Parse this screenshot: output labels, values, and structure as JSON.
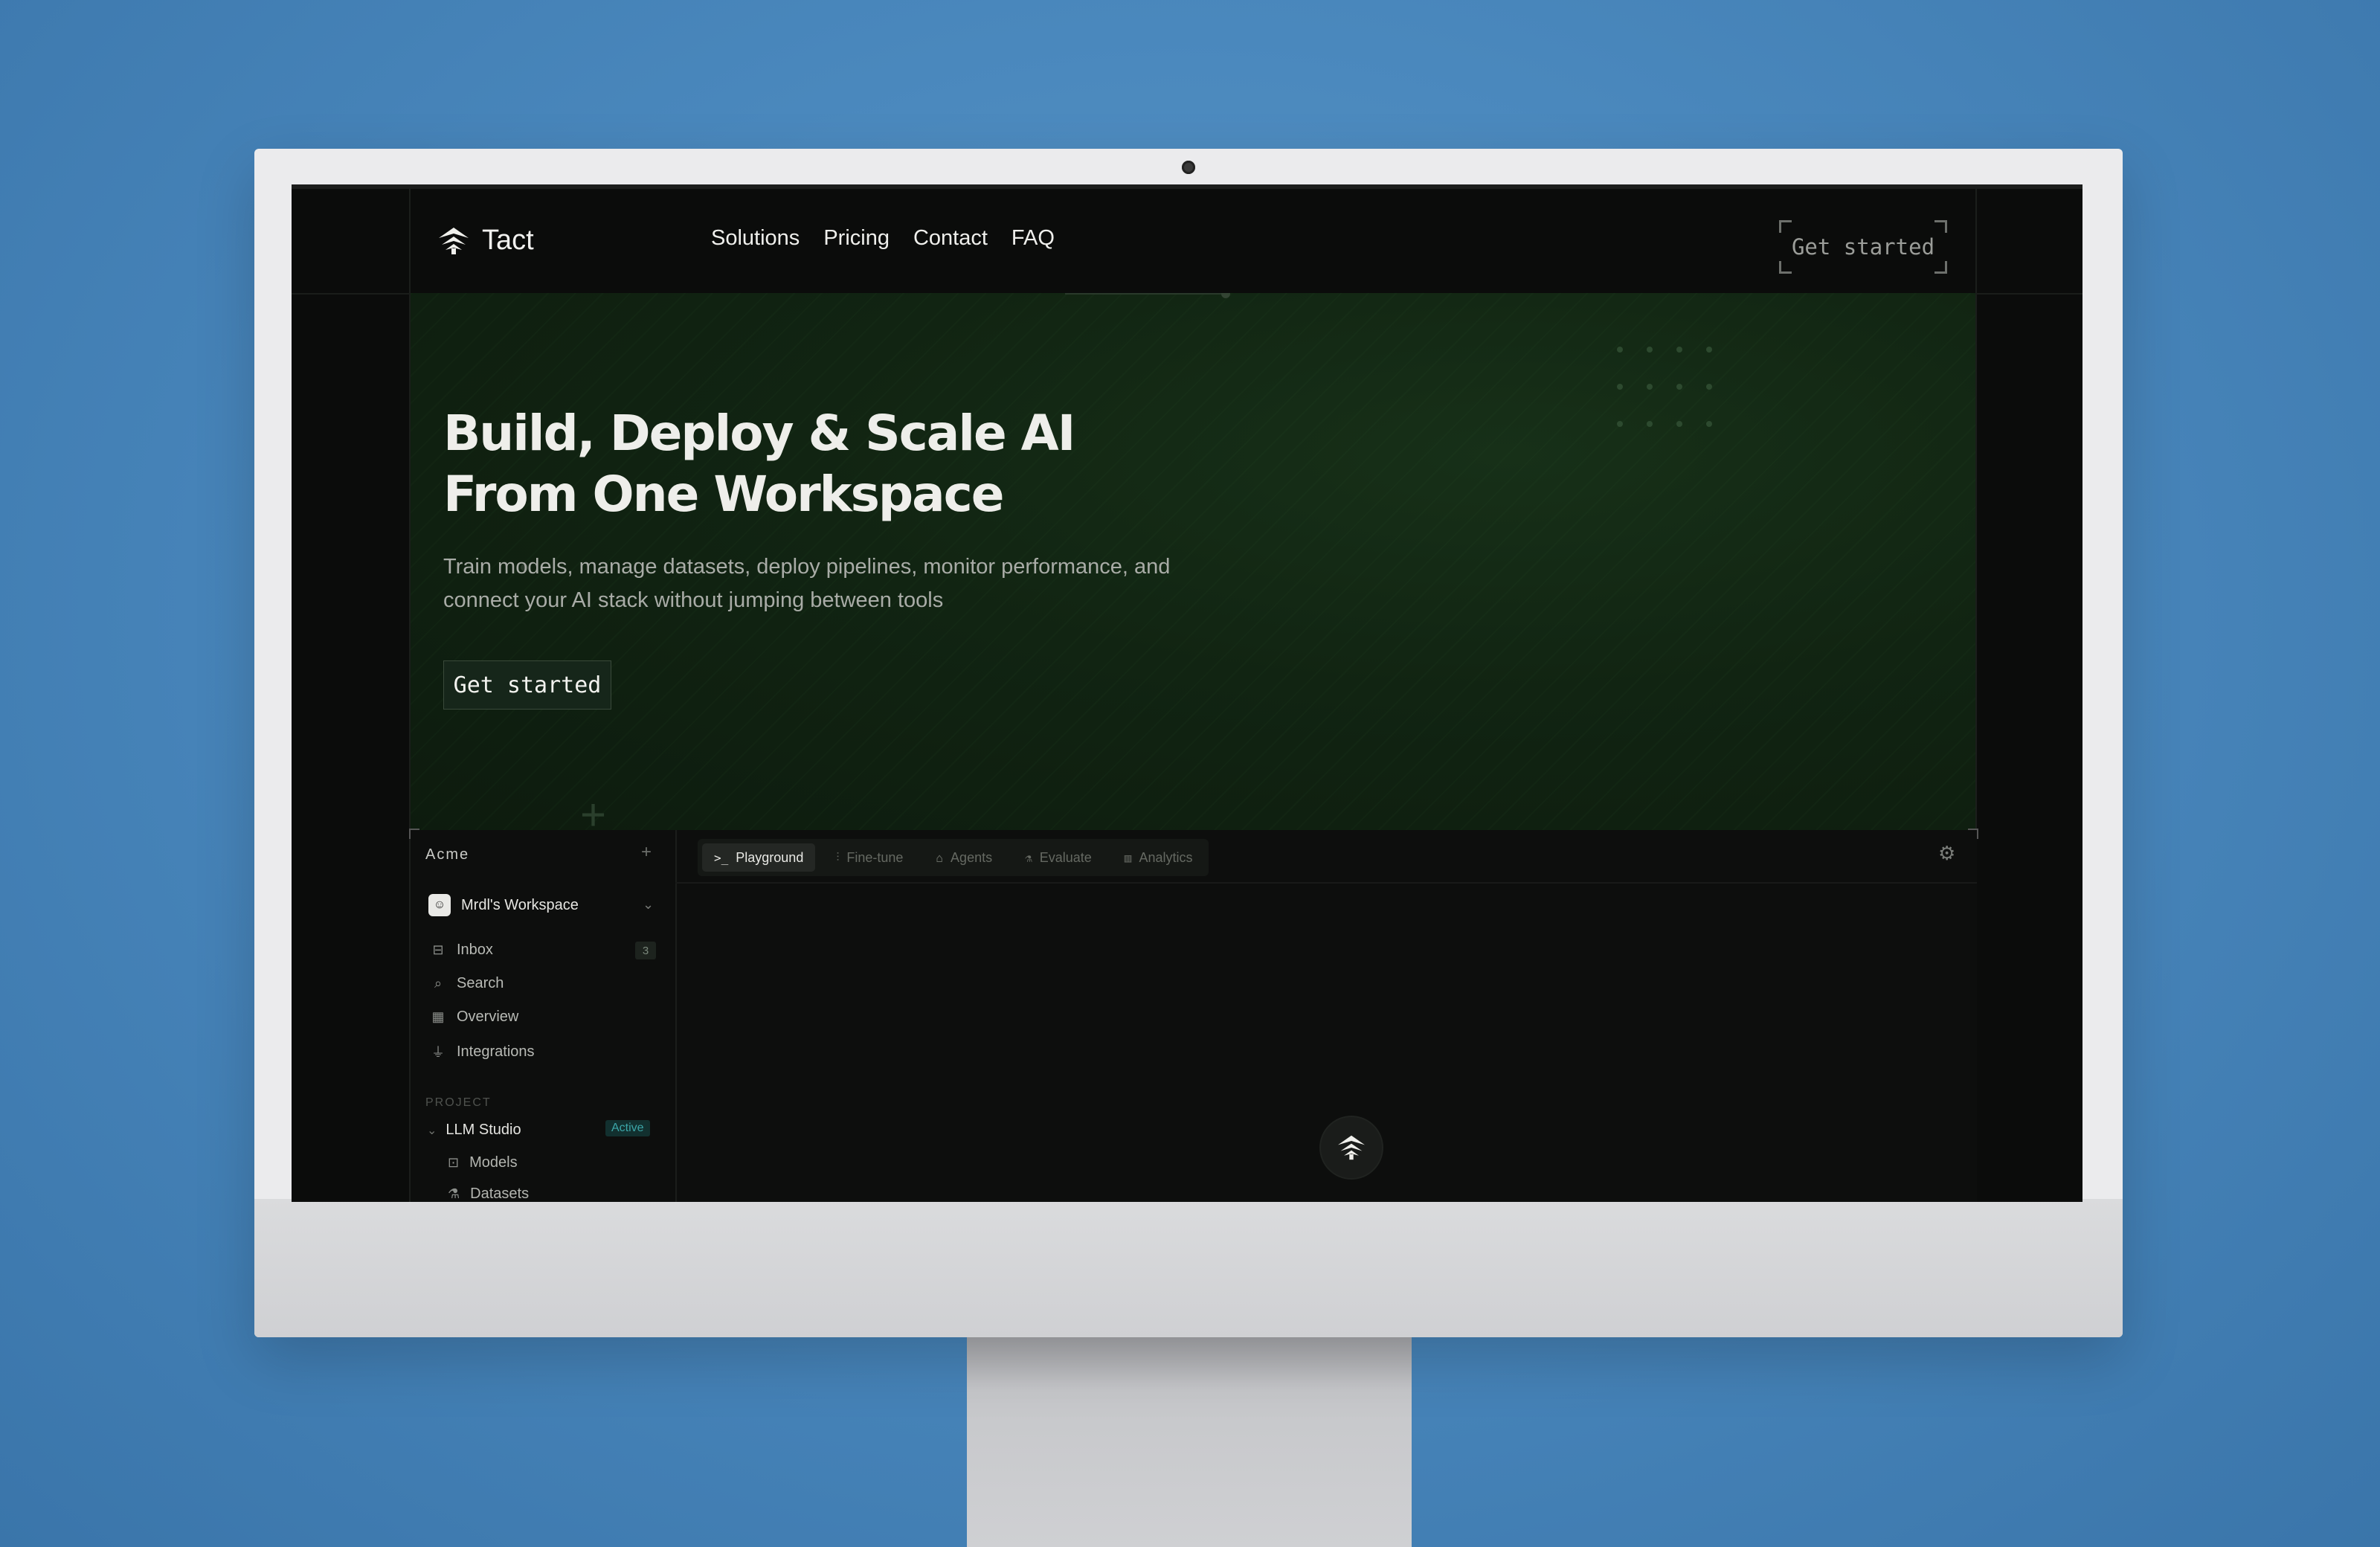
{
  "nav": {
    "brand": "Tact",
    "links": [
      "Solutions",
      "Pricing",
      "Contact",
      "FAQ"
    ],
    "cta": "Get started"
  },
  "hero": {
    "title_line1": "Build, Deploy & Scale AI",
    "title_line2": "From One Workspace",
    "subtitle": "Train models, manage datasets, deploy pipelines, monitor performance, and connect your AI stack without jumping between tools",
    "cta": "Get started"
  },
  "app": {
    "brand": "Acme",
    "workspace": "Mrdl's Workspace",
    "sidebar": [
      {
        "label": "Inbox",
        "icon": "inbox-icon",
        "badge": "3"
      },
      {
        "label": "Search",
        "icon": "search-icon"
      },
      {
        "label": "Overview",
        "icon": "grid-icon"
      },
      {
        "label": "Integrations",
        "icon": "plug-icon"
      }
    ],
    "project_heading": "PROJECT",
    "project": {
      "name": "LLM Studio",
      "status": "Active"
    },
    "project_items": [
      "Models",
      "Datasets"
    ],
    "tabs": [
      {
        "label": "Playground",
        "icon": ">_",
        "active": true
      },
      {
        "label": "Fine-tune",
        "icon": "sliders-icon"
      },
      {
        "label": "Agents",
        "icon": "robot-icon"
      },
      {
        "label": "Evaluate",
        "icon": "flask-icon"
      },
      {
        "label": "Analytics",
        "icon": "bar-chart-icon"
      }
    ]
  },
  "colors": {
    "background": "#4a88bd",
    "screen": "#0b0c0b",
    "hero_green": "#112412",
    "accent_teal": "#3ca6a8"
  }
}
